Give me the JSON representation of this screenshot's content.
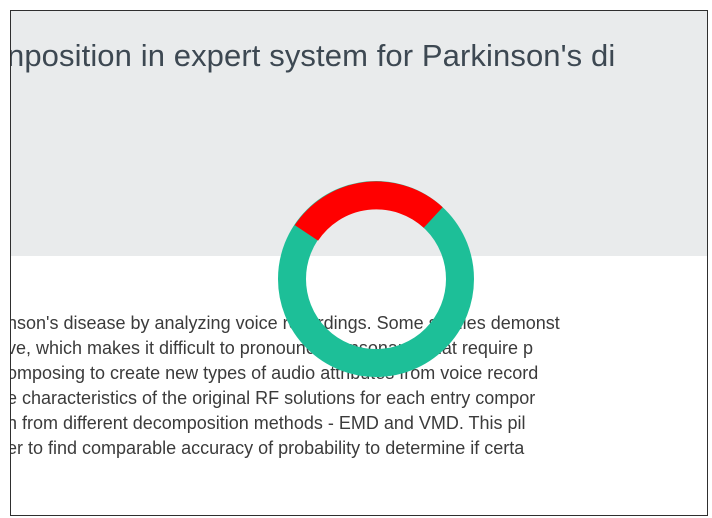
{
  "article": {
    "title": "nposition in expert system for Parkinson's di",
    "abstract_lines": [
      "nson's disease by analyzing voice recordings. Some studies demonst",
      "ve, which makes it difficult to pronounce consonants that require p",
      "omposing to create new types of audio attributes from voice record",
      "e characteristics of the original RF solutions for each entry compor",
      "n from different decomposition methods - EMD and VMD. This pil",
      "er to find comparable accuracy of probability to determine if certa"
    ]
  },
  "loader": {
    "icon": "loading-spinner-icon",
    "track_color": "#1dbf98",
    "progress_color": "#ff0000"
  }
}
